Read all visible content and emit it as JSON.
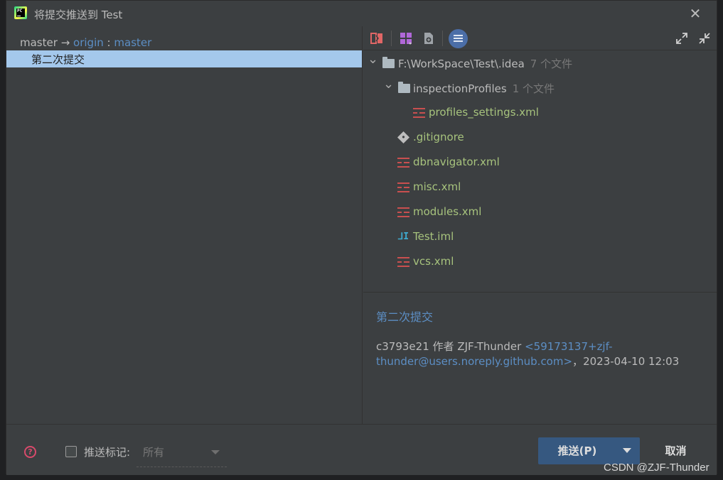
{
  "window": {
    "title": "将提交推送到 Test"
  },
  "left": {
    "branch": {
      "local": "master",
      "arrow": "→",
      "remote": "origin",
      "sep": ":",
      "remote_branch": "master"
    },
    "commits": [
      {
        "message": "第二次提交"
      }
    ]
  },
  "toolbar": {
    "icons": [
      "diff-icon",
      "group-by-icon",
      "show-diff-icon",
      "list-view-icon",
      "expand-all-icon",
      "collapse-all-icon"
    ]
  },
  "tree": {
    "root": {
      "path": "F:\\WorkSpace\\Test\\.idea",
      "count": "7 个文件"
    },
    "folder": {
      "name": "inspectionProfiles",
      "count": "1 个文件"
    },
    "files": [
      {
        "name": "profiles_settings.xml",
        "icon": "xml-icon"
      },
      {
        "name": ".gitignore",
        "icon": "git-icon"
      },
      {
        "name": "dbnavigator.xml",
        "icon": "xml-icon"
      },
      {
        "name": "misc.xml",
        "icon": "xml-icon"
      },
      {
        "name": "modules.xml",
        "icon": "xml-icon"
      },
      {
        "name": "Test.iml",
        "icon": "iml-icon"
      },
      {
        "name": "vcs.xml",
        "icon": "xml-icon"
      }
    ]
  },
  "details": {
    "message": "第二次提交",
    "hash": "c3793e21",
    "by": "作者",
    "author": "ZJF-Thunder",
    "email": "<59173137+zjf-thunder@users.noreply.github.com>",
    "date_sep": "，",
    "date": "2023-04-10 12:03"
  },
  "bottom": {
    "push_tags_label": "推送标记:",
    "tags_value": "所有",
    "push_label": "推送(P)",
    "cancel_label": "取消"
  },
  "watermark": "CSDN @ZJF-Thunder",
  "colors": {
    "accent": "#365880",
    "link": "#5c8ec4",
    "selection": "#a4c8ec",
    "file_green": "#a7c37d"
  }
}
